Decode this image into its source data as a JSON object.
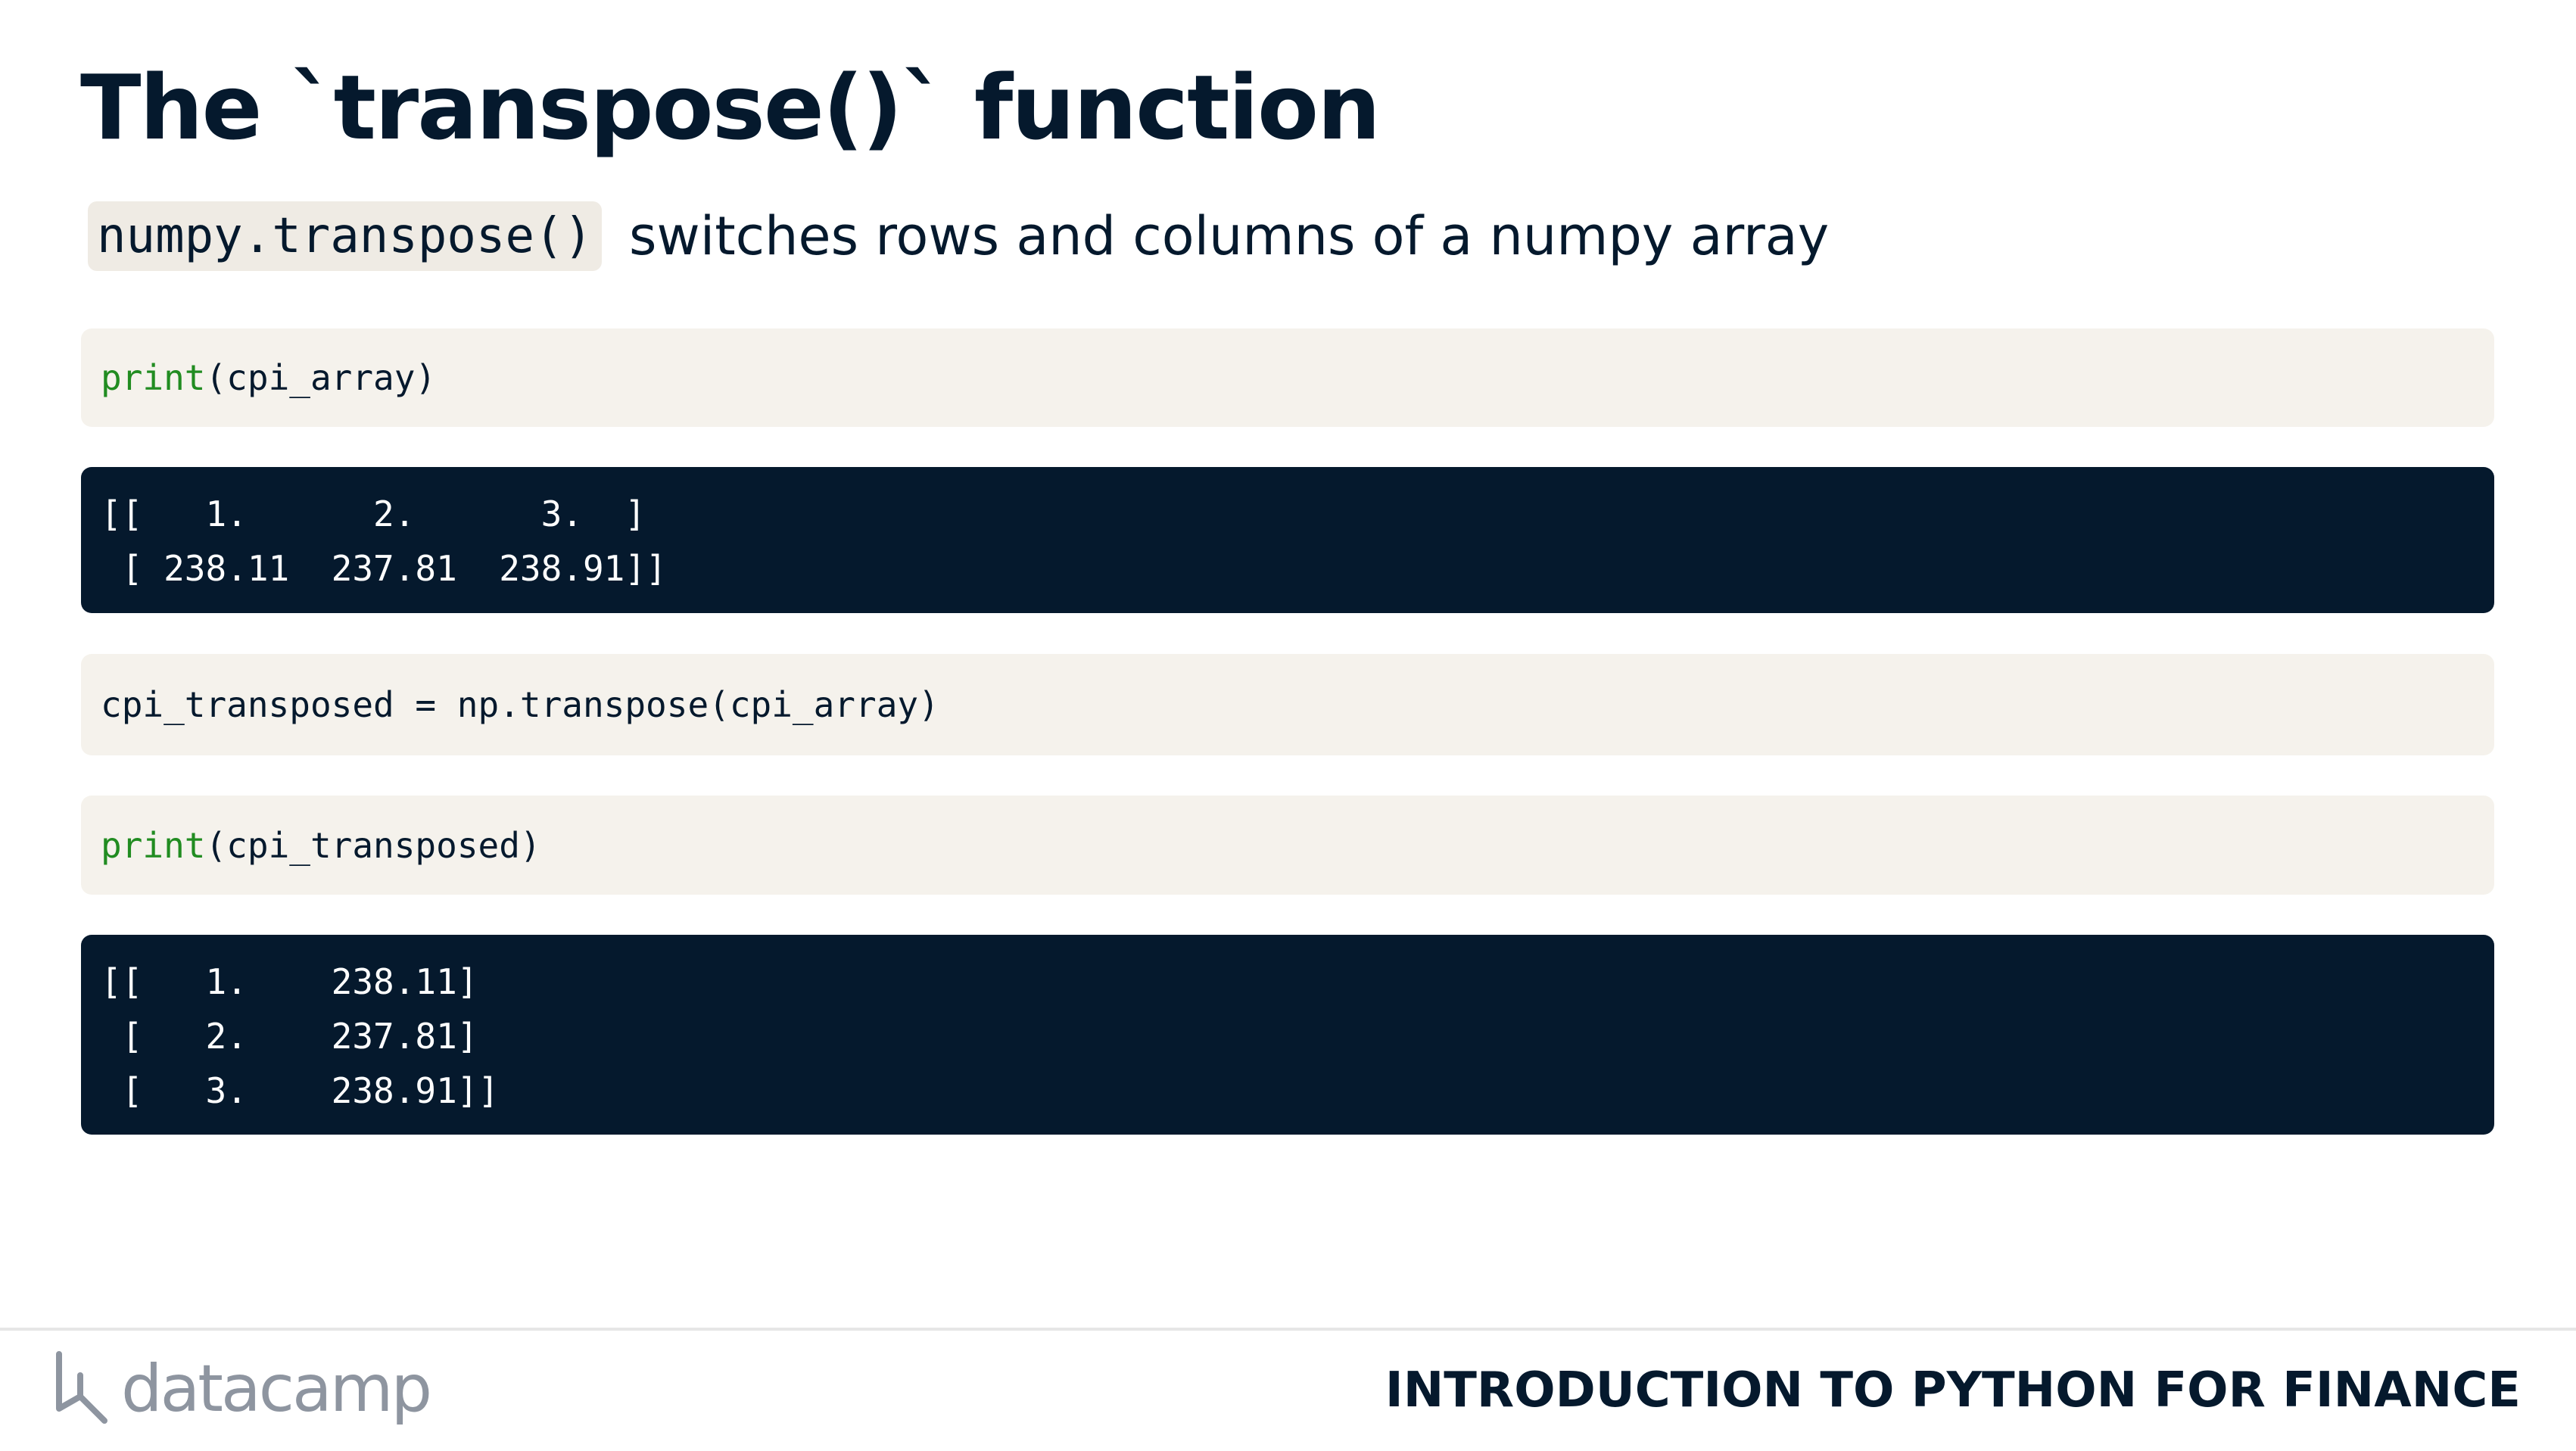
{
  "slide": {
    "title": "The `transpose()` function",
    "subtitle_code": "numpy.transpose()",
    "subtitle_text": "switches rows and columns of a numpy array"
  },
  "code_blocks": [
    {
      "kind": "input",
      "keyword": "print",
      "rest": "(cpi_array)"
    },
    {
      "kind": "output",
      "lines": [
        "[[   1.      2.      3.  ]",
        " [ 238.11  237.81  238.91]]"
      ]
    },
    {
      "kind": "input",
      "keyword": "",
      "rest": "cpi_transposed = np.transpose(cpi_array)"
    },
    {
      "kind": "input",
      "keyword": "print",
      "rest": "(cpi_transposed)"
    },
    {
      "kind": "output",
      "lines": [
        "[[   1.    238.11]",
        " [   2.    237.81]",
        " [   3.    238.91]]"
      ]
    }
  ],
  "footer": {
    "brand": "datacamp",
    "course_title": "INTRODUCTION TO PYTHON FOR FINANCE"
  },
  "colors": {
    "navy": "#05192d",
    "code_input_bg": "#f5f2ec",
    "keyword_green": "#218c21",
    "logo_gray": "#8e95a0"
  },
  "icons": {
    "logo": "datacamp-logo-icon"
  }
}
